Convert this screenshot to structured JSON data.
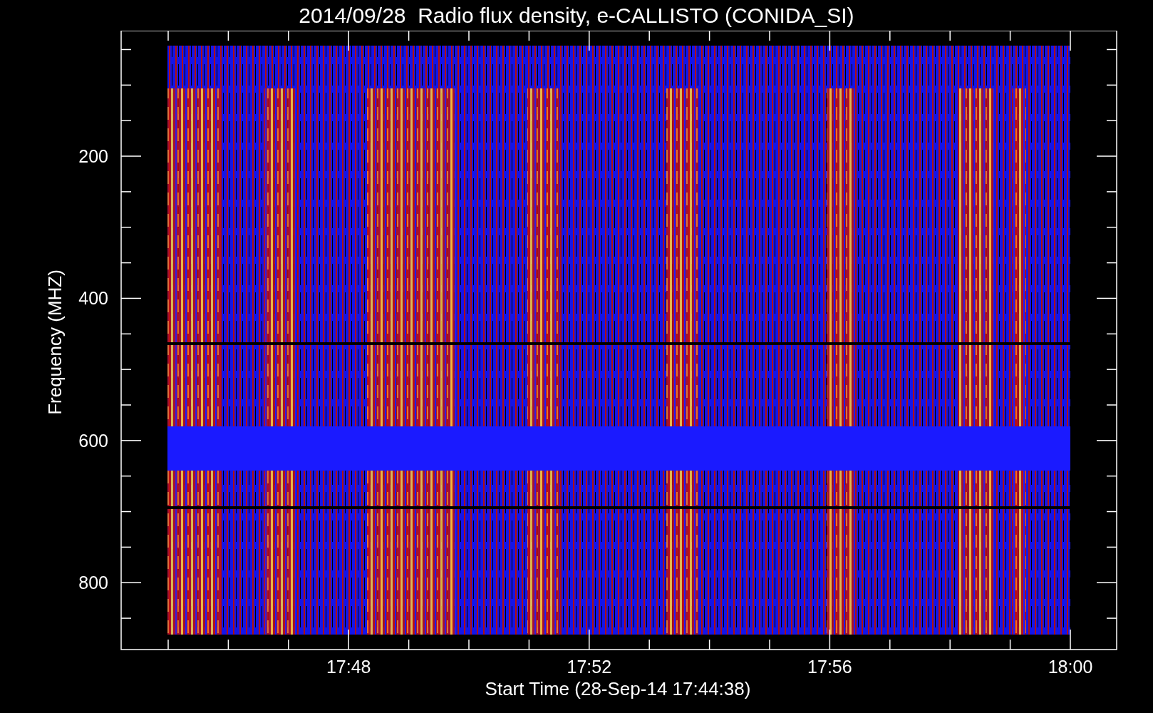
{
  "title": "2014/09/28  Radio flux density, e-CALLISTO (CONIDA_SI)",
  "y_axis": {
    "label": "Frequency (MHZ)",
    "ticks": [
      "200",
      "400",
      "600",
      "800"
    ]
  },
  "x_axis": {
    "label": "Start Time (28-Sep-14 17:44:38)",
    "ticks": [
      "17:48",
      "17:52",
      "17:56",
      "18:00"
    ]
  }
}
